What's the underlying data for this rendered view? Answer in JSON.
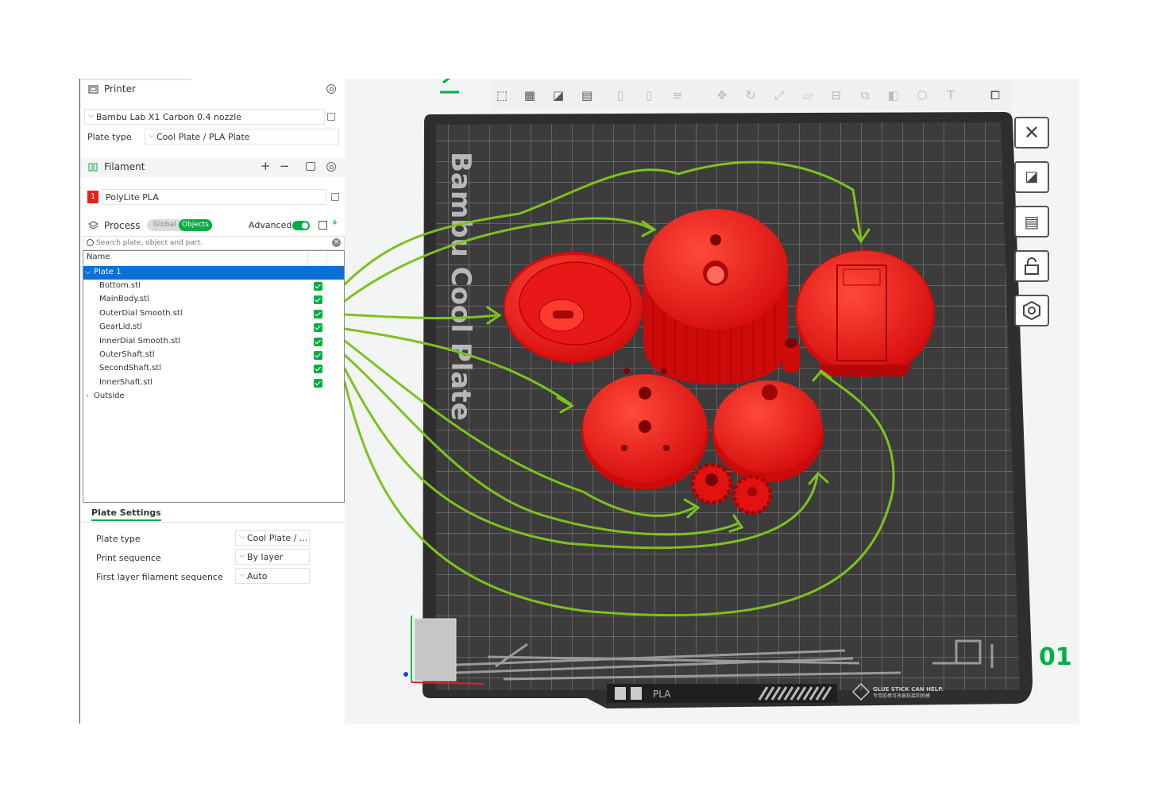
{
  "printer": {
    "section_label": "Printer",
    "model": "Bambu Lab X1 Carbon 0.4 nozzle",
    "plate_type_label": "Plate type",
    "plate_type_value": "Cool Plate / PLA Plate"
  },
  "filament": {
    "section_label": "Filament",
    "add_symbol": "+",
    "remove_symbol": "−",
    "slot_number": "1",
    "slot_color": "#e8201a",
    "material": "PolyLite PLA"
  },
  "process": {
    "section_label": "Process",
    "tab_global": "Global",
    "tab_objects": "Objects",
    "advanced_label": "Advanced"
  },
  "search": {
    "placeholder": "Search plate, object and part."
  },
  "object_list": {
    "column_name": "Name",
    "plate_label": "Plate 1",
    "items": [
      {
        "name": "Bottom.stl",
        "checked": true
      },
      {
        "name": "MainBody.stl",
        "checked": true
      },
      {
        "name": "OuterDial Smooth.stl",
        "checked": true
      },
      {
        "name": "GearLid.stl",
        "checked": true
      },
      {
        "name": "InnerDial Smooth.stl",
        "checked": true
      },
      {
        "name": "OuterShaft.stl",
        "checked": true
      },
      {
        "name": "SecondShaft.stl",
        "checked": true
      },
      {
        "name": "InnerShaft.stl",
        "checked": true
      }
    ],
    "group_label": "Outside"
  },
  "plate_settings": {
    "title": "Plate Settings",
    "plate_type_label": "Plate type",
    "plate_type_value": "Cool Plate / ...",
    "print_sequence_label": "Print sequence",
    "print_sequence_value": "By layer",
    "first_layer_label": "First layer filament sequence",
    "first_layer_value": "Auto"
  },
  "build_plate": {
    "plate_name": "Bambu Cool Plate",
    "footer_material": "PLA",
    "footer_notice": "GLUE STICK CAN HELP.",
    "footer_notice_cn": "专用胶棒可改善粘接和脱模",
    "plate_index": "01"
  },
  "colors": {
    "accent": "#00ae42",
    "selection": "#0a6fd6",
    "part_red": "#ff1a1a",
    "annotation_green": "#7dc21e",
    "plate_dark": "#3c3c3c"
  },
  "toolbar_icons": [
    "add-icon",
    "add-plate-icon",
    "auto-orient-icon",
    "arrange-icon",
    "split-objects-icon",
    "split-parts-icon",
    "layers-icon",
    "move-icon",
    "rotate-icon",
    "scale-icon",
    "lay-on-face-icon",
    "cut-icon",
    "mesh-boolean-icon",
    "support-paint-icon",
    "seam-paint-icon",
    "text-icon",
    "assembly-view-icon"
  ],
  "side_buttons": [
    "close-icon",
    "auto-orient-icon",
    "arrange-icon",
    "lock-icon",
    "plate-settings-icon"
  ]
}
